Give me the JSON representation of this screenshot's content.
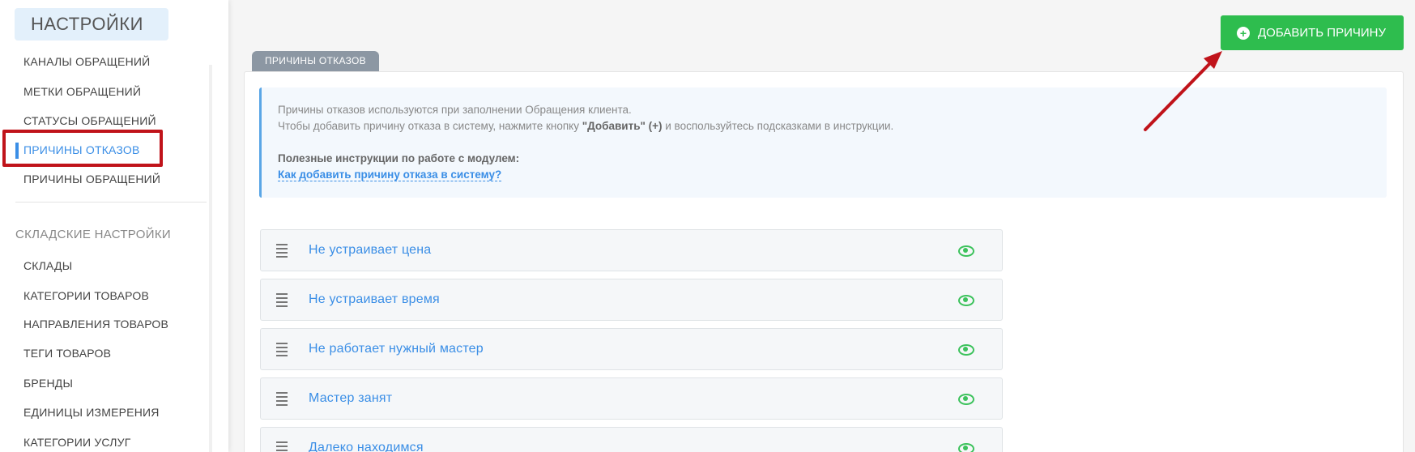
{
  "sidebar": {
    "title": "НАСТРОЙКИ",
    "items_top": [
      {
        "label": "КАНАЛЫ ОБРАЩЕНИЙ"
      },
      {
        "label": "МЕТКИ ОБРАЩЕНИЙ"
      },
      {
        "label": "СТАТУСЫ ОБРАЩЕНИЙ"
      },
      {
        "label": "ПРИЧИНЫ ОТКАЗОВ",
        "active": true
      },
      {
        "label": "ПРИЧИНЫ ОБРАЩЕНИЙ"
      }
    ],
    "section_title": "СКЛАДСКИЕ НАСТРОЙКИ",
    "items_bottom": [
      {
        "label": "СКЛАДЫ"
      },
      {
        "label": "КАТЕГОРИИ ТОВАРОВ"
      },
      {
        "label": "НАПРАВЛЕНИЯ ТОВАРОВ"
      },
      {
        "label": "ТЕГИ ТОВАРОВ"
      },
      {
        "label": "БРЕНДЫ"
      },
      {
        "label": "ЕДИНИЦЫ ИЗМЕРЕНИЯ"
      },
      {
        "label": "КАТЕГОРИИ УСЛУГ"
      }
    ]
  },
  "toolbar": {
    "add_label": "ДОБАВИТЬ ПРИЧИНУ",
    "add_icon": "plus-circle-icon"
  },
  "tab": {
    "label": "ПРИЧИНЫ ОТКАЗОВ"
  },
  "info": {
    "line1": "Причины отказов используются при заполнении Обращения клиента.",
    "line2_pre": "Чтобы добавить причину отказа в систему, нажмите кнопку ",
    "line2_bold": "\"Добавить\" (+)",
    "line2_post": " и воспользуйтесь подсказками в инструкции.",
    "instructions_title": "Полезные инструкции по работе с модулем:",
    "instructions_link": "Как добавить причину отказа в систему?"
  },
  "reasons": [
    {
      "label": "Не устраивает цена"
    },
    {
      "label": "Не устраивает время"
    },
    {
      "label": "Не работает нужный мастер"
    },
    {
      "label": "Мастер занят"
    },
    {
      "label": "Далеко находимся"
    }
  ],
  "colors": {
    "accent": "#3a8ee6",
    "add_button": "#2ebd4e",
    "annotation": "#c0131a",
    "eye": "#3cc25c"
  }
}
